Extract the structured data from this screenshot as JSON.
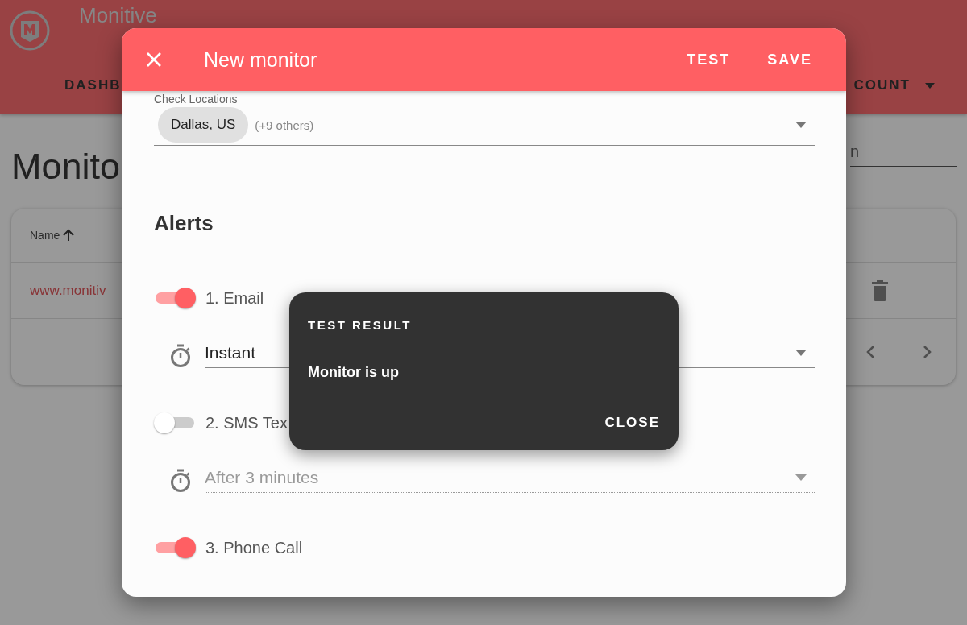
{
  "app_bar": {
    "brand": "Monitive",
    "nav": [
      {
        "label": "DASHB",
        "kind": "tab"
      },
      {
        "label": "COUNT",
        "kind": "menu"
      }
    ]
  },
  "page": {
    "title": "Monito",
    "search": {
      "placeholder": "n"
    },
    "table": {
      "columns": [
        {
          "label": "Name",
          "sorted": true
        }
      ],
      "rows": [
        {
          "name": "www.monitiv"
        }
      ]
    }
  },
  "dialog": {
    "title": "New monitor",
    "actions": [
      "TEST",
      "SAVE"
    ],
    "locations": {
      "label": "Check Locations",
      "chip": "Dallas, US",
      "more": "(+9 others)"
    },
    "alerts_heading": "Alerts",
    "alerts": [
      {
        "label": "1. Email",
        "on": true,
        "delay": "Instant"
      },
      {
        "label": "2. SMS Tex",
        "on": false,
        "delay": "After 3 minutes"
      },
      {
        "label": "3. Phone Call",
        "on": true
      }
    ]
  },
  "snackbar": {
    "title": "TEST RESULT",
    "message": "Monitor is up",
    "action": "CLOSE"
  }
}
